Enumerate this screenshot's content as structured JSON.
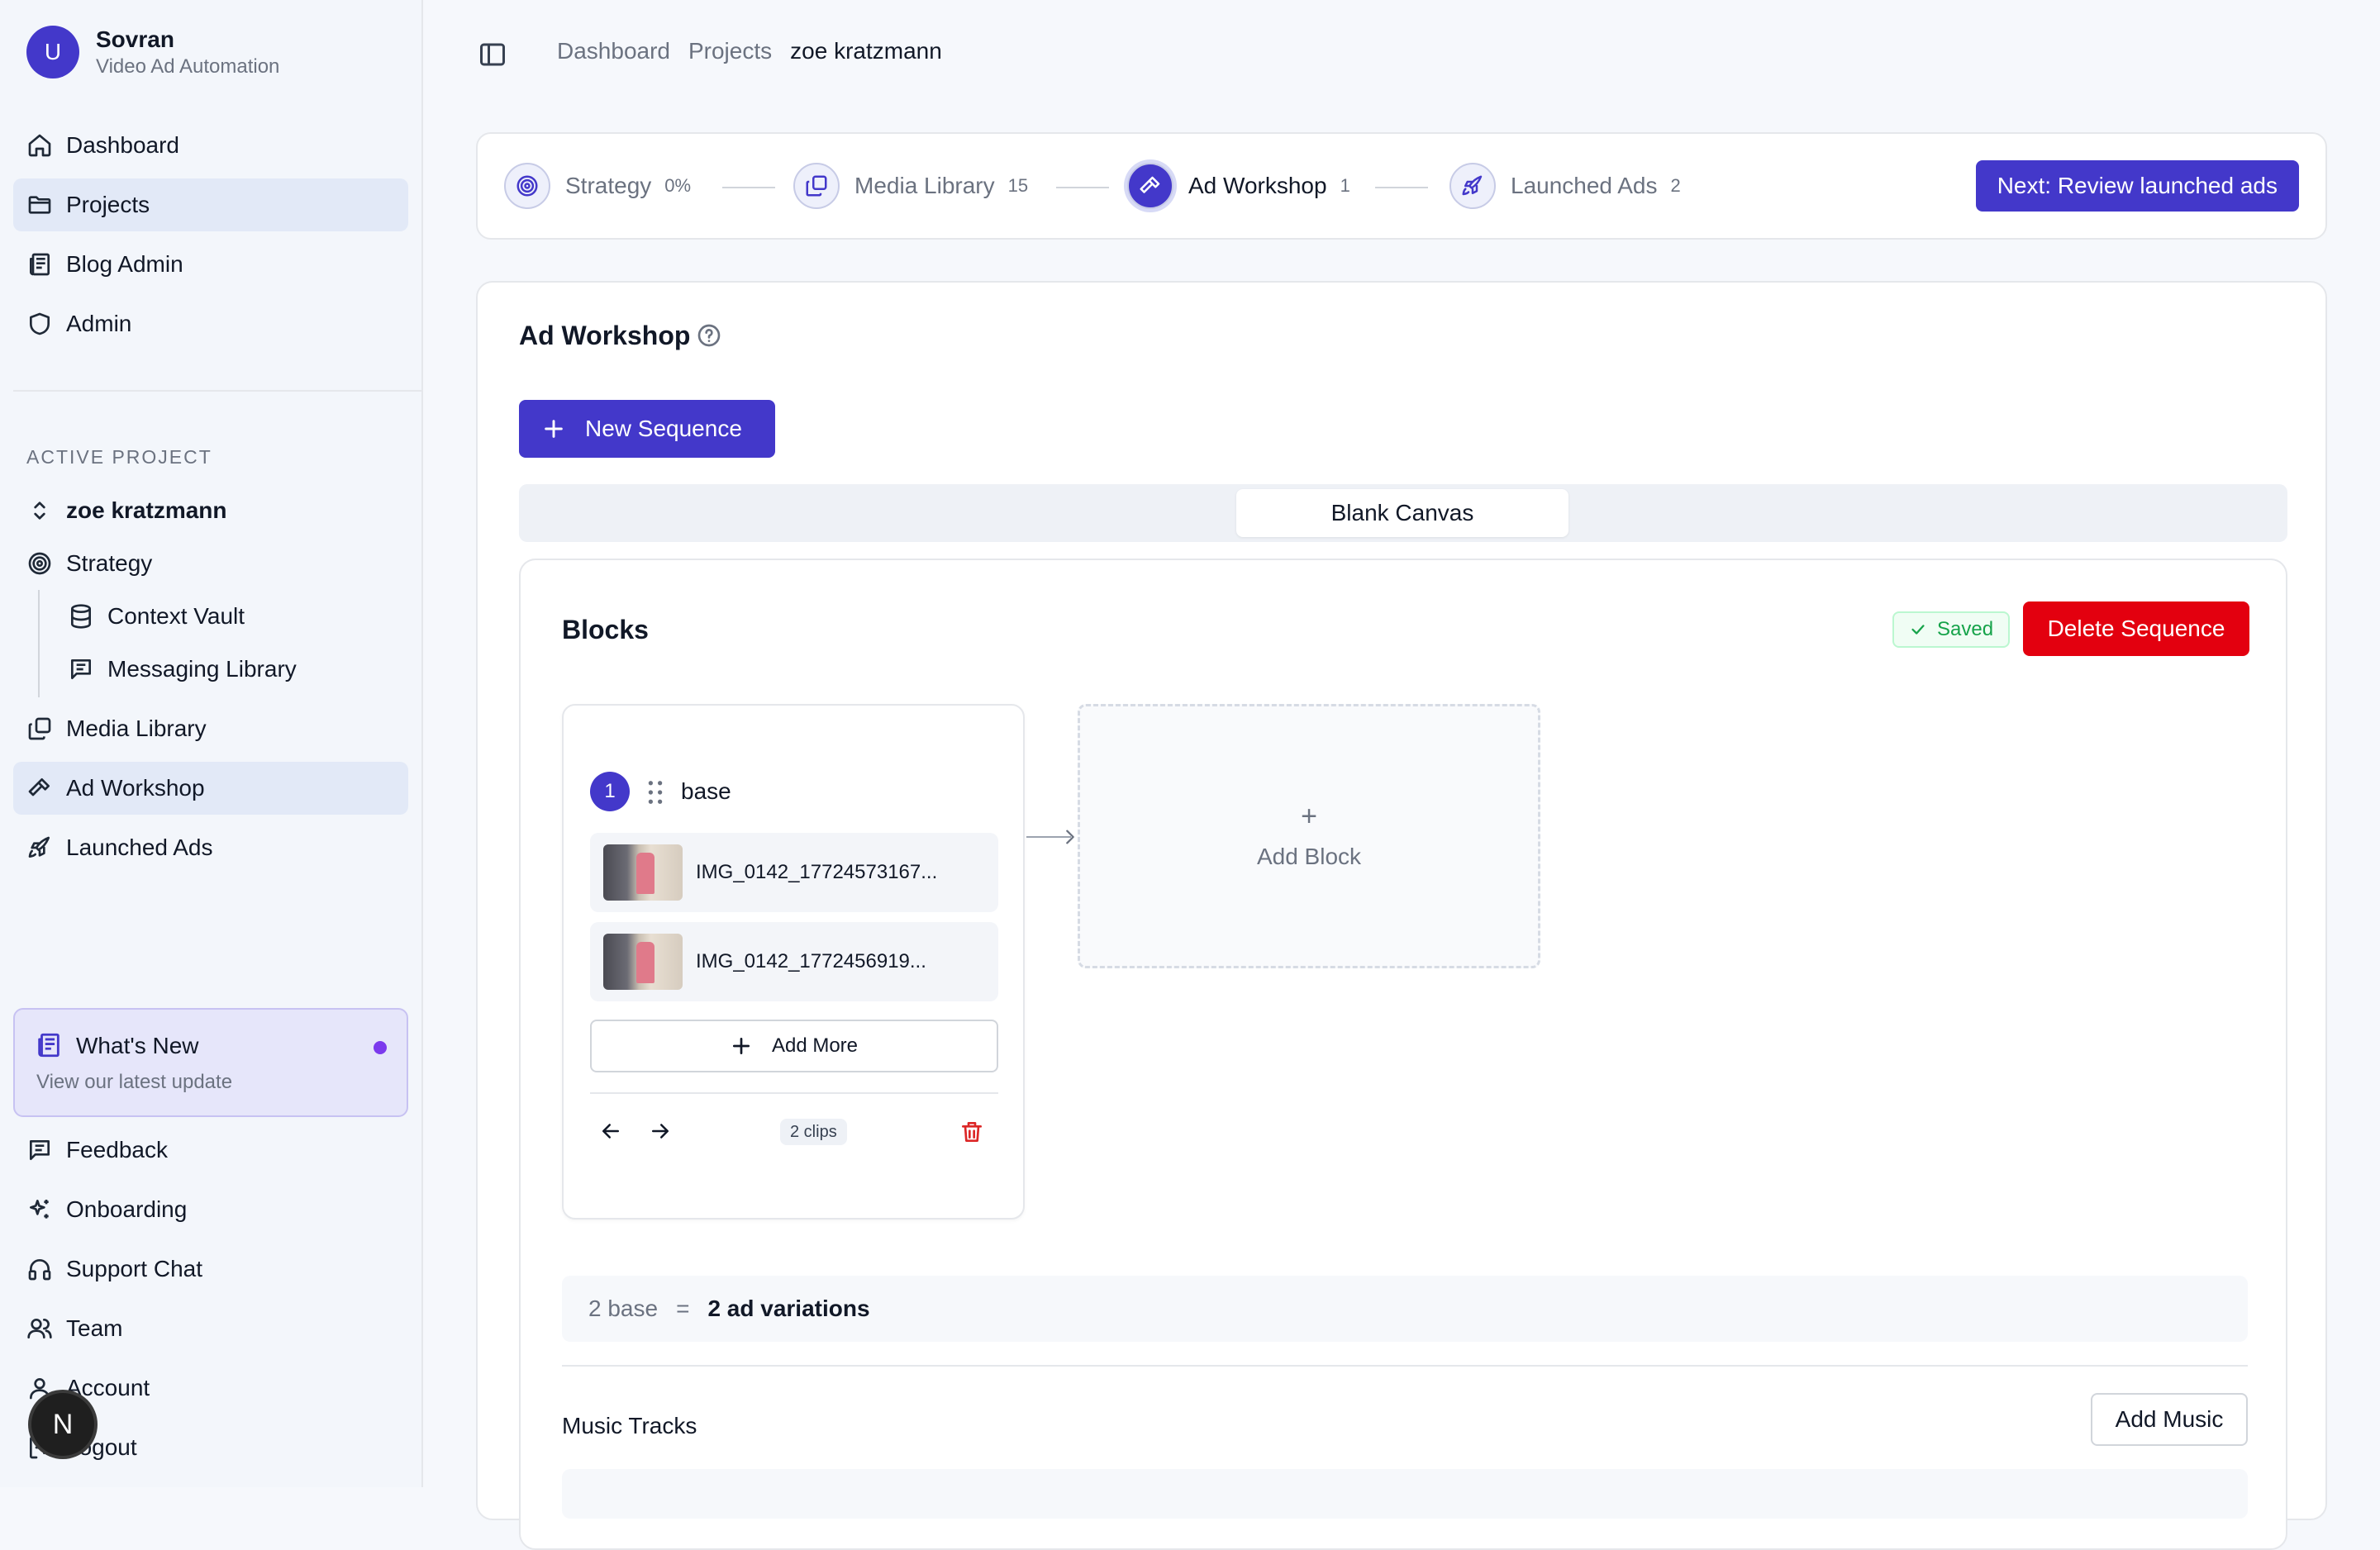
{
  "brand": {
    "initial": "U",
    "name": "Sovran",
    "subtitle": "Video Ad Automation"
  },
  "nav": [
    {
      "label": "Dashboard",
      "icon": "home-icon"
    },
    {
      "label": "Projects",
      "icon": "folder-icon",
      "active": true
    },
    {
      "label": "Blog Admin",
      "icon": "newspaper-icon"
    },
    {
      "label": "Admin",
      "icon": "shield-icon"
    }
  ],
  "active_project": {
    "section_label": "ACTIVE PROJECT",
    "project_name": "zoe kratzmann",
    "items": [
      {
        "label": "Strategy",
        "icon": "target-icon"
      },
      {
        "label": "Context Vault",
        "icon": "database-icon"
      },
      {
        "label": "Messaging Library",
        "icon": "message-square-icon"
      },
      {
        "label": "Media Library",
        "icon": "copy-icon"
      },
      {
        "label": "Ad Workshop",
        "icon": "hammer-icon",
        "active": true
      },
      {
        "label": "Launched Ads",
        "icon": "rocket-icon"
      }
    ]
  },
  "whats_new": {
    "title": "What's New",
    "subtitle": "View our latest update"
  },
  "bottom_nav": [
    {
      "label": "Feedback",
      "icon": "message-square-icon"
    },
    {
      "label": "Onboarding",
      "icon": "sparkles-icon"
    },
    {
      "label": "Support Chat",
      "icon": "headphones-icon"
    },
    {
      "label": "Team",
      "icon": "users-icon"
    },
    {
      "label": "Account",
      "icon": "user-icon"
    },
    {
      "label": "Logout",
      "icon": "logout-icon"
    }
  ],
  "dev_badge": "N",
  "breadcrumb": [
    "Dashboard",
    "Projects",
    "zoe kratzmann"
  ],
  "stepper": {
    "steps": [
      {
        "label": "Strategy",
        "count": "0%"
      },
      {
        "label": "Media Library",
        "count": "15"
      },
      {
        "label": "Ad Workshop",
        "count": "1",
        "active": true
      },
      {
        "label": "Launched Ads",
        "count": "2"
      }
    ],
    "next_label": "Next: Review launched ads"
  },
  "workshop": {
    "title": "Ad Workshop",
    "new_sequence_label": "New Sequence",
    "tab_label": "Blank Canvas",
    "blocks_title": "Blocks",
    "saved_label": "Saved",
    "delete_label": "Delete Sequence",
    "block": {
      "number": "1",
      "name": "base",
      "clips": [
        "IMG_0142_17724573167...",
        "IMG_0142_1772456919..."
      ],
      "add_more_label": "Add More",
      "clips_count_label": "2 clips"
    },
    "add_block_label": "Add Block",
    "formula": {
      "left": "2 base",
      "eq": "=",
      "right": "2 ad variations"
    },
    "music_title": "Music Tracks",
    "add_music_label": "Add Music"
  },
  "colors": {
    "accent": "#4338ca",
    "danger": "#e3000f",
    "success": "#16a34a"
  }
}
